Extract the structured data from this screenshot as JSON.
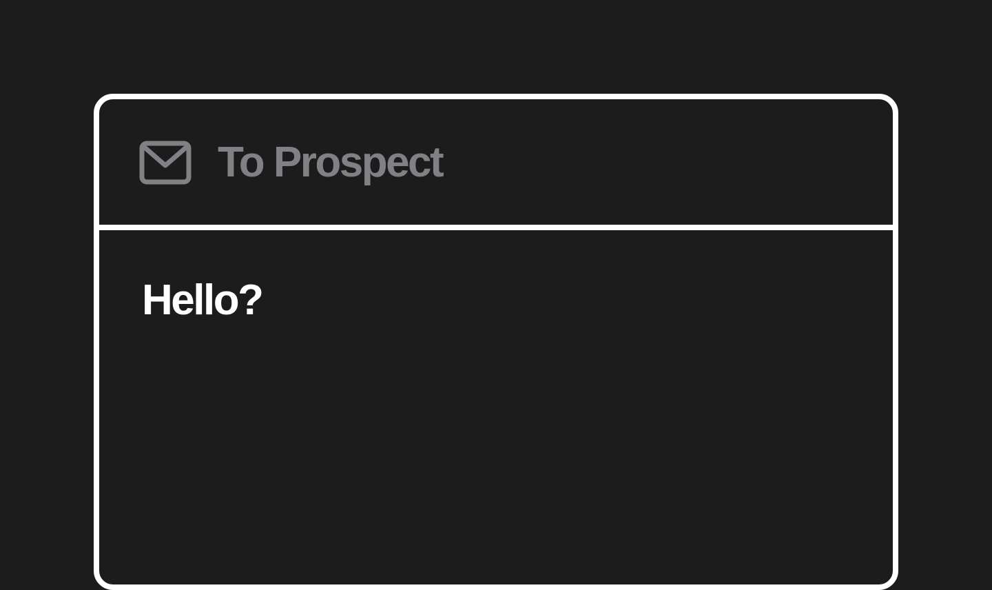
{
  "compose": {
    "to_label": "To Prospect",
    "to_icon": "mail-icon",
    "message_body": "Hello?"
  },
  "colors": {
    "background": "#1c1c1c",
    "border": "#ffffff",
    "recipient_text": "#808184",
    "body_text": "#ffffff"
  }
}
